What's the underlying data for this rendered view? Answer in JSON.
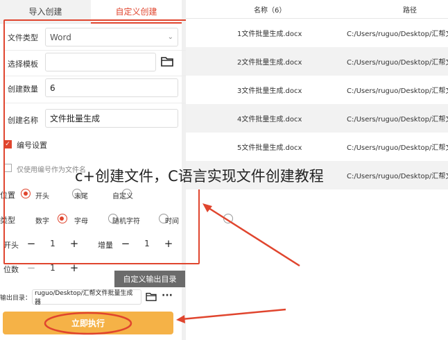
{
  "tabs": {
    "import_label": "导入创建",
    "custom_label": "自定义创建"
  },
  "form": {
    "file_type_label": "文件类型",
    "file_type_value": "Word",
    "template_label": "选择模板",
    "template_value": "",
    "count_label": "创建数量",
    "count_value": "6",
    "name_label": "创建名称",
    "name_value": "文件批量生成",
    "numbering_label": "编号设置",
    "only_number_label": "仅使用编号作为文件名",
    "position_label": "位置",
    "position_options": [
      "开头",
      "末尾",
      "自定义"
    ],
    "type_label": "类型",
    "type_options": [
      "数字",
      "字母",
      "随机字符",
      "时间"
    ],
    "start_label": "开头",
    "start_value": "1",
    "increment_label": "增量",
    "increment_value": "1",
    "digits_label": "位数",
    "digits_value": "1",
    "output_label": "输出目录：",
    "output_value": "ruguo/Desktop/汇帮文件批量生成器"
  },
  "tooltip": "自定义输出目录",
  "execute_label": "立即执行",
  "table": {
    "name_header": "名称（6）",
    "path_header": "路径",
    "rows": [
      {
        "name": "1文件批量生成.docx",
        "path": "C:/Users/ruguo/Desktop/汇帮文"
      },
      {
        "name": "2文件批量生成.docx",
        "path": "C:/Users/ruguo/Desktop/汇帮文"
      },
      {
        "name": "3文件批量生成.docx",
        "path": "C:/Users/ruguo/Desktop/汇帮文"
      },
      {
        "name": "4文件批量生成.docx",
        "path": "C:/Users/ruguo/Desktop/汇帮文"
      },
      {
        "name": "5文件批量生成.docx",
        "path": "C:/Users/ruguo/Desktop/汇帮文"
      },
      {
        "name": "",
        "path": "C:/Users/ruguo/Desktop/汇帮文"
      }
    ]
  },
  "overlay_caption": "c+创建文件，C语言实现文件创建教程",
  "colors": {
    "accent": "#e0452e",
    "execute": "#f5b247"
  }
}
